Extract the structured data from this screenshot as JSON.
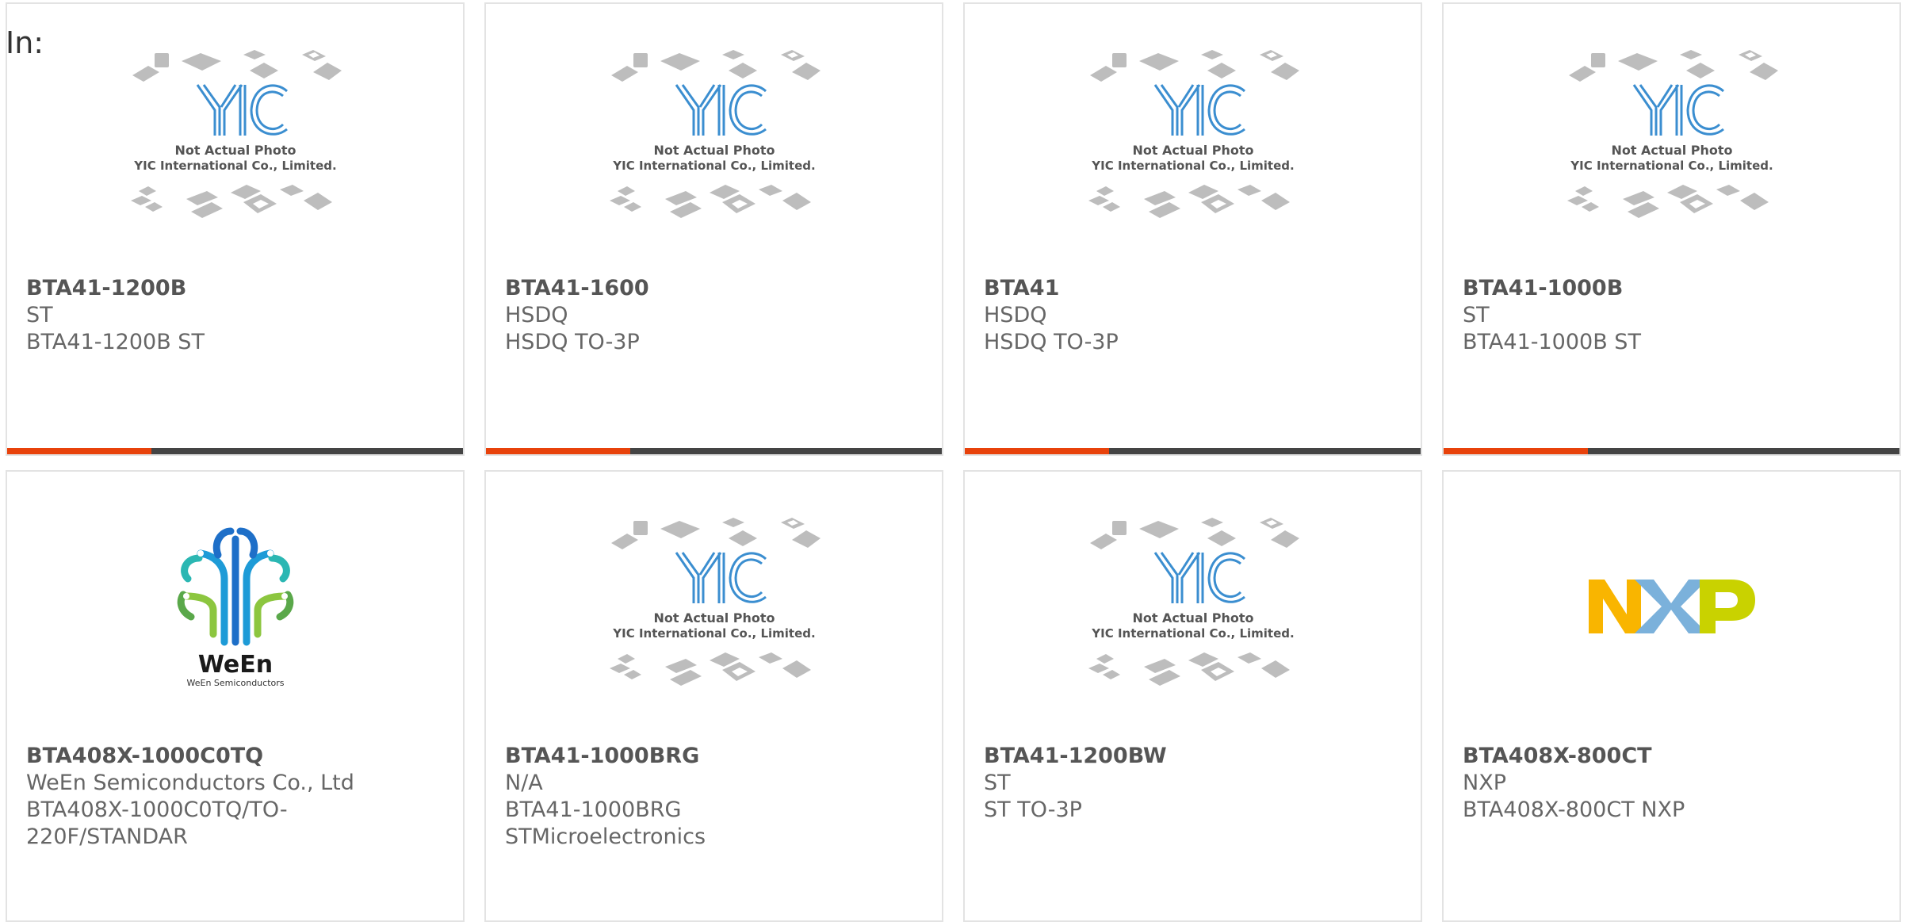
{
  "header": {
    "in_label": "In:"
  },
  "placeholder_image": {
    "logo_text": "YIC",
    "caption_line1": "Not Actual Photo",
    "caption_line2": "YIC International Co., Limited."
  },
  "ween_logo": {
    "name": "WeEn",
    "tagline": "WeEn Semiconductors"
  },
  "nxp_logo": {
    "letters": [
      "N",
      "X",
      "P"
    ],
    "colors": [
      "#f9b500",
      "#7bb1db",
      "#c9d200"
    ]
  },
  "colors": {
    "accent": "#e8420b",
    "bar": "#444444",
    "border": "#e3e3e3"
  },
  "cards": [
    {
      "part": "BTA41-1200B",
      "line1": "ST",
      "line2": "BTA41-1200B ST",
      "line3": "",
      "image": "placeholder"
    },
    {
      "part": "BTA41-1600",
      "line1": "HSDQ",
      "line2": "HSDQ TO-3P",
      "line3": "",
      "image": "placeholder"
    },
    {
      "part": "BTA41",
      "line1": "HSDQ",
      "line2": "HSDQ TO-3P",
      "line3": "",
      "image": "placeholder"
    },
    {
      "part": "BTA41-1000B",
      "line1": "ST",
      "line2": "BTA41-1000B ST",
      "line3": "",
      "image": "placeholder"
    },
    {
      "part": "BTA408X-1000C0TQ",
      "line1": "WeEn Semiconductors Co., Ltd",
      "line2": "BTA408X-1000C0TQ/TO-",
      "line3": "220F/STANDAR",
      "image": "ween-logo"
    },
    {
      "part": "BTA41-1000BRG",
      "line1": "N/A",
      "line2": "BTA41-1000BRG",
      "line3": "STMicroelectronics",
      "image": "placeholder"
    },
    {
      "part": "BTA41-1200BW",
      "line1": "ST",
      "line2": "ST TO-3P",
      "line3": "",
      "image": "placeholder"
    },
    {
      "part": "BTA408X-800CT",
      "line1": "NXP",
      "line2": "BTA408X-800CT NXP",
      "line3": "",
      "image": "nxp-logo"
    }
  ]
}
